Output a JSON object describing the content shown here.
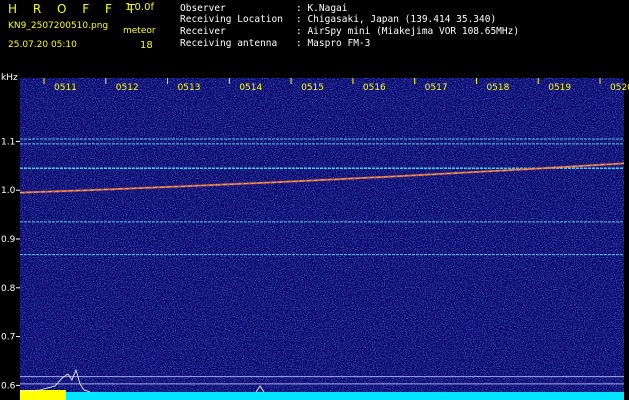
{
  "header": {
    "program_name": "H R O F F T",
    "version": "1.0.0f",
    "filename": "KN9_2507200510.png",
    "mode": "meteor",
    "timestamp": "25.07.20 05:10",
    "count": "18",
    "info": [
      {
        "label": "Observer",
        "value": ": K.Nagai"
      },
      {
        "label": "Receiving Location",
        "value": ": Chigasaki, Japan (139.414 35.340)"
      },
      {
        "label": "Receiver",
        "value": ": AirSpy mini (Miakejima VOR 108.65MHz)"
      },
      {
        "label": "Receiving antenna",
        "value": ": Maspro FM-3"
      }
    ]
  },
  "plot": {
    "y_unit": "kHz",
    "x_tick_labels": [
      "0511",
      "0512",
      "0513",
      "0514",
      "0515",
      "0516",
      "0517",
      "0518",
      "0519",
      "0520"
    ],
    "y_tick_labels": [
      "1.1",
      "1.0",
      "0.9",
      "0.8",
      "0.7",
      "0.6"
    ],
    "y_ticks": [
      1.1,
      1.0,
      0.9,
      0.8,
      0.7,
      0.6
    ],
    "y_range": [
      0.57,
      1.23
    ],
    "x_range_minutes": [
      0,
      10
    ],
    "colors": {
      "background": "#0a0a6e",
      "tick_labels": "#ffff00",
      "carrier_line": "#7fd8ff",
      "drift_trace": "#ff6040",
      "spectrum_fill": "#00e5ff",
      "level_bar": "#ffff00"
    }
  },
  "chart_data": {
    "type": "heatmap",
    "title": "",
    "xlabel": "",
    "ylabel": "kHz",
    "x_ticks": [
      "0511",
      "0512",
      "0513",
      "0514",
      "0515",
      "0516",
      "0517",
      "0518",
      "0519",
      "0520"
    ],
    "y_ticks": [
      1.1,
      1.0,
      0.9,
      0.8,
      0.7,
      0.6
    ],
    "ylim": [
      0.57,
      1.23
    ],
    "horizontal_lines_khz": [
      1.105,
      1.095,
      1.045,
      0.935,
      0.868,
      0.618,
      0.603
    ],
    "drift_trace": {
      "start_khz": 0.995,
      "end_khz": 1.055
    }
  }
}
